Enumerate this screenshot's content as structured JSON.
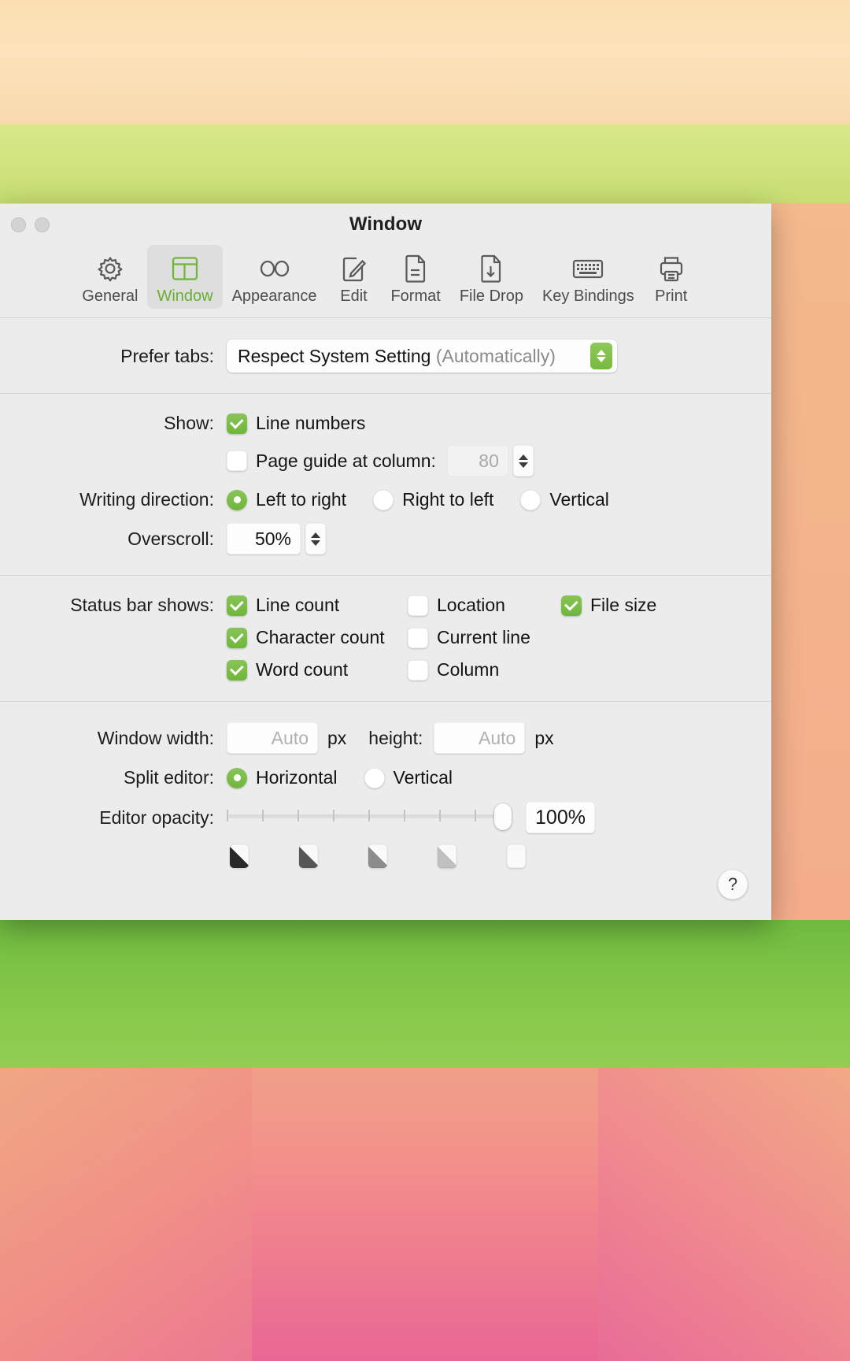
{
  "window": {
    "title": "Window"
  },
  "toolbar": {
    "items": [
      {
        "label": "General",
        "icon": "gear-icon",
        "selected": false
      },
      {
        "label": "Window",
        "icon": "window-layout-icon",
        "selected": true
      },
      {
        "label": "Appearance",
        "icon": "glasses-icon",
        "selected": false
      },
      {
        "label": "Edit",
        "icon": "pencil-note-icon",
        "selected": false
      },
      {
        "label": "Format",
        "icon": "document-icon",
        "selected": false
      },
      {
        "label": "File Drop",
        "icon": "file-download-icon",
        "selected": false
      },
      {
        "label": "Key Bindings",
        "icon": "keyboard-icon",
        "selected": false
      },
      {
        "label": "Print",
        "icon": "printer-icon",
        "selected": false
      }
    ]
  },
  "prefer_tabs": {
    "label": "Prefer tabs:",
    "value": "Respect System Setting",
    "value_suffix": "(Automatically)"
  },
  "show": {
    "label": "Show:",
    "line_numbers": {
      "label": "Line numbers",
      "checked": true
    },
    "page_guide": {
      "label": "Page guide at column:",
      "checked": false,
      "value": "80"
    }
  },
  "writing_direction": {
    "label": "Writing direction:",
    "options": [
      {
        "label": "Left to right",
        "selected": true
      },
      {
        "label": "Right to left",
        "selected": false
      },
      {
        "label": "Vertical",
        "selected": false
      }
    ]
  },
  "overscroll": {
    "label": "Overscroll:",
    "value": "50%"
  },
  "status_bar": {
    "label": "Status bar shows:",
    "column1": [
      {
        "label": "Line count",
        "checked": true
      },
      {
        "label": "Character count",
        "checked": true
      },
      {
        "label": "Word count",
        "checked": true
      }
    ],
    "column2": [
      {
        "label": "Location",
        "checked": false
      },
      {
        "label": "Current line",
        "checked": false
      },
      {
        "label": "Column",
        "checked": false
      }
    ],
    "column3": [
      {
        "label": "File size",
        "checked": true
      }
    ]
  },
  "window_size": {
    "width_label": "Window width:",
    "width_placeholder": "Auto",
    "width_unit": "px",
    "height_label": "height:",
    "height_placeholder": "Auto",
    "height_unit": "px"
  },
  "split_editor": {
    "label": "Split editor:",
    "options": [
      {
        "label": "Horizontal",
        "selected": true
      },
      {
        "label": "Vertical",
        "selected": false
      }
    ]
  },
  "editor_opacity": {
    "label": "Editor opacity:",
    "value": "100%",
    "slider_percent": 100,
    "tick_count": 8,
    "swatch_opacities": [
      1.0,
      0.78,
      0.52,
      0.28,
      0.0
    ]
  },
  "help": {
    "label": "?"
  },
  "colors": {
    "accent_green": "#6fb63a",
    "selected_label": "#68b030",
    "window_bg": "#ececec",
    "text": "#141414"
  }
}
